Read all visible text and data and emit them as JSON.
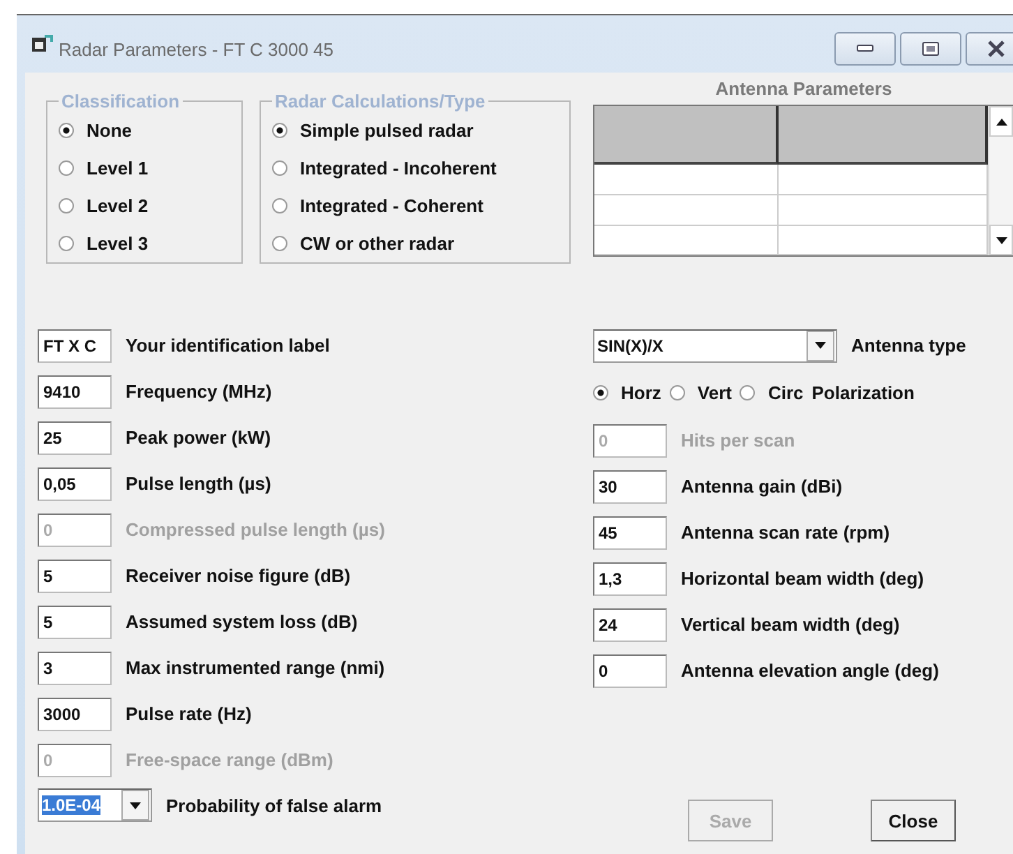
{
  "window": {
    "title": "Radar Parameters - FT C 3000 45"
  },
  "classification": {
    "title": "Classification",
    "options": [
      {
        "label": "None",
        "selected": true
      },
      {
        "label": "Level 1",
        "selected": false
      },
      {
        "label": "Level 2",
        "selected": false
      },
      {
        "label": "Level 3",
        "selected": false
      }
    ]
  },
  "radar_type": {
    "title": "Radar Calculations/Type",
    "options": [
      {
        "label": "Simple pulsed radar",
        "selected": true
      },
      {
        "label": "Integrated - Incoherent",
        "selected": false
      },
      {
        "label": "Integrated - Coherent",
        "selected": false
      },
      {
        "label": "CW or other radar",
        "selected": false
      }
    ]
  },
  "antenna_parameters": {
    "title": "Antenna Parameters"
  },
  "left_fields": [
    {
      "kind": "input",
      "value": "FT X C",
      "label": "Your identification label",
      "disabled": false
    },
    {
      "kind": "input",
      "value": "9410",
      "label": "Frequency (MHz)",
      "disabled": false
    },
    {
      "kind": "input",
      "value": "25",
      "label": "Peak power (kW)",
      "disabled": false
    },
    {
      "kind": "input",
      "value": "0,05",
      "label": "Pulse length (µs)",
      "disabled": false
    },
    {
      "kind": "input",
      "value": "0",
      "label": "Compressed pulse length (µs)",
      "disabled": true
    },
    {
      "kind": "input",
      "value": "5",
      "label": "Receiver noise figure (dB)",
      "disabled": false
    },
    {
      "kind": "input",
      "value": "5",
      "label": "Assumed system loss (dB)",
      "disabled": false
    },
    {
      "kind": "input",
      "value": "3",
      "label": "Max instrumented range (nmi)",
      "disabled": false
    },
    {
      "kind": "input",
      "value": "3000",
      "label": "Pulse rate (Hz)",
      "disabled": false
    },
    {
      "kind": "input",
      "value": "0",
      "label": "Free-space range (dBm)",
      "disabled": true
    },
    {
      "kind": "combo",
      "value": "1.0E-04",
      "label": "Probability of false alarm",
      "highlighted": true
    }
  ],
  "antenna_type": {
    "value": "SIN(X)/X",
    "label": "Antenna type"
  },
  "polarization": {
    "label": "Polarization",
    "options": [
      {
        "label": "Horz",
        "selected": true
      },
      {
        "label": "Vert",
        "selected": false
      },
      {
        "label": "Circ",
        "selected": false
      }
    ]
  },
  "right_fields": [
    {
      "value": "0",
      "label": "Hits per scan",
      "disabled": true
    },
    {
      "value": "30",
      "label": "Antenna gain (dBi)",
      "disabled": false
    },
    {
      "value": "45",
      "label": "Antenna scan rate (rpm)",
      "disabled": false
    },
    {
      "value": "1,3",
      "label": "Horizontal beam width (deg)",
      "disabled": false
    },
    {
      "value": "24",
      "label": "Vertical beam width (deg)",
      "disabled": false
    },
    {
      "value": "0",
      "label": "Antenna elevation angle (deg)",
      "disabled": false
    }
  ],
  "buttons": [
    {
      "label": "Save",
      "disabled": true
    },
    {
      "label": "Close",
      "disabled": false
    }
  ]
}
